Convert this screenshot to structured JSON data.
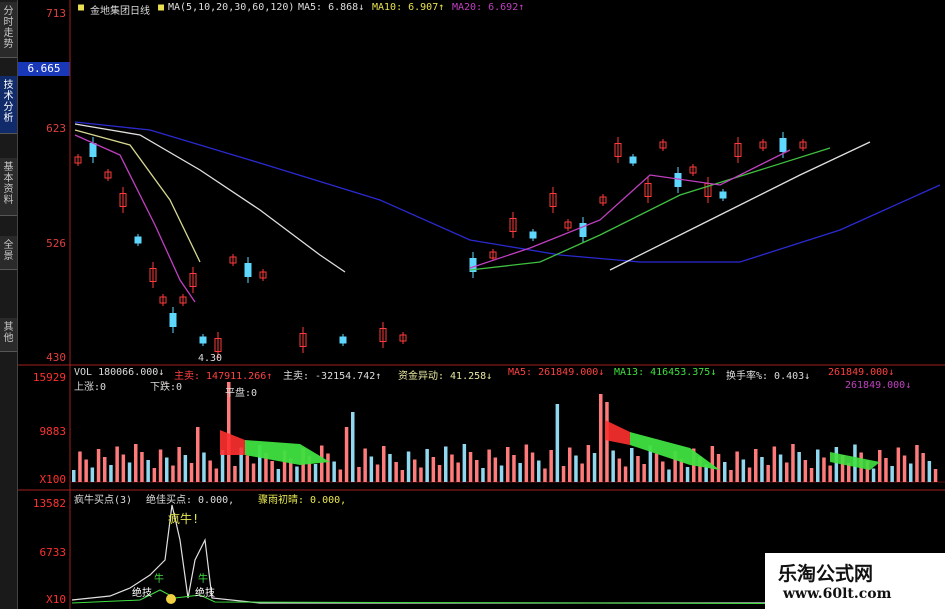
{
  "sidebar": {
    "tabs": [
      {
        "label": "分时走势"
      },
      {
        "label": "技术分析"
      },
      {
        "label": "基本资料"
      },
      {
        "label": "全景"
      },
      {
        "label": "其他"
      }
    ]
  },
  "main_panel": {
    "title": "金地集团日线",
    "ma_label": "MA(5,10,20,30,60,120)",
    "ma5": "MA5: 6.868↓",
    "ma10": "MA10: 6.907↑",
    "ma20": "MA20: 6.692↑",
    "y_labels": [
      "713",
      "623",
      "526",
      "430"
    ],
    "current_price": "6.665",
    "low_annotation": "4.30",
    "colors": {
      "ma_blue": "#2a2ad0",
      "ma_white": "#e0e0e0",
      "ma_yellow": "#d8d890",
      "ma_purple": "#c040c0",
      "ma_green": "#40c040",
      "up": "#ff3b3b",
      "down": "#5fd8ff"
    }
  },
  "volume_panel": {
    "legend": [
      {
        "text": "VOL 180066.000↓",
        "color": "#dddddd"
      },
      {
        "text": "主卖: 147911.266↑",
        "color": "#ff4040"
      },
      {
        "text": "主卖: -32154.742↑",
        "color": "#dddddd"
      },
      {
        "text": "资金异动: 41.258↓",
        "color": "#e8e8a0"
      },
      {
        "text": "MA5: 261849.000↓",
        "color": "#ff4040"
      },
      {
        "text": "MA13: 416453.375↓",
        "color": "#40e040"
      },
      {
        "text": "换手率%: 0.403↓",
        "color": "#dddddd"
      },
      {
        "text": "261849.000↓",
        "color": "#ff4040"
      },
      {
        "text": "261849.000↓",
        "color": "#c040c0"
      }
    ],
    "legend2": [
      {
        "text": "上涨:0",
        "color": "#dddddd"
      },
      {
        "text": "下跌:0",
        "color": "#dddddd"
      },
      {
        "text": "平盘:0",
        "color": "#dddddd"
      }
    ],
    "y_labels": [
      "15929",
      "9883",
      "X100"
    ]
  },
  "indicator_panel": {
    "legend": [
      {
        "text": "疯牛买点(3)",
        "color": "#dddddd"
      },
      {
        "text": "绝佳买点: 0.000,",
        "color": "#dddddd"
      },
      {
        "text": "骤雨初晴: 0.000,",
        "color": "#e8e850"
      }
    ],
    "y_labels": [
      "13582",
      "6733",
      "X10"
    ],
    "annotations": [
      "疯牛!",
      "牛",
      "牛",
      "绝技",
      "绝技"
    ]
  },
  "watermark": {
    "title": "乐淘公式网",
    "url": "www.60lt.com"
  }
}
